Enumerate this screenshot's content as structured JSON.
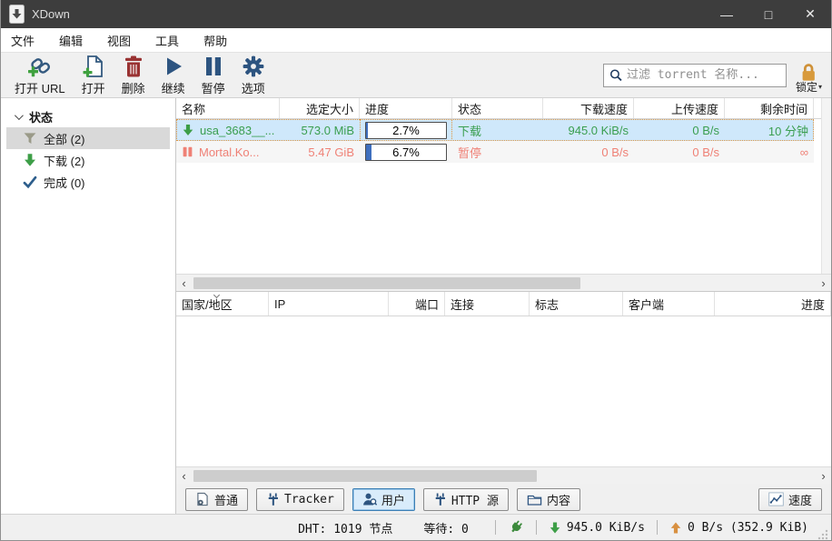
{
  "window": {
    "title": "XDown",
    "controls": {
      "minimize": "—",
      "maximize": "□",
      "close": "✕"
    }
  },
  "menu": {
    "items": [
      "文件",
      "编辑",
      "视图",
      "工具",
      "帮助"
    ]
  },
  "toolbar": {
    "buttons": [
      {
        "label": "打开 URL",
        "icon": "link-add-icon"
      },
      {
        "label": "打开",
        "icon": "file-add-icon"
      },
      {
        "label": "删除",
        "icon": "trash-icon"
      },
      {
        "label": "继续",
        "icon": "play-icon"
      },
      {
        "label": "暂停",
        "icon": "pause-icon"
      },
      {
        "label": "选项",
        "icon": "gear-icon"
      }
    ],
    "search": {
      "placeholder": "过滤 torrent 名称..."
    },
    "lock": {
      "label": "锁定",
      "dropdown": "▾"
    }
  },
  "sidebar": {
    "header": "状态",
    "items": [
      {
        "label": "全部 (2)",
        "icon": "filter-icon",
        "selected": true
      },
      {
        "label": "下载 (2)",
        "icon": "download-arrow-icon",
        "selected": false
      },
      {
        "label": "完成 (0)",
        "icon": "check-icon",
        "selected": false
      }
    ]
  },
  "downloads_table": {
    "columns": [
      "名称",
      "选定大小",
      "进度",
      "状态",
      "下载速度",
      "上传速度",
      "剩余时间"
    ],
    "rows": [
      {
        "name": "usa_3683__...",
        "size": "573.0 MiB",
        "progress": "2.7%",
        "progress_value": 2.7,
        "status": "下载",
        "down_speed": "945.0 KiB/s",
        "up_speed": "0 B/s",
        "eta": "10 分钟",
        "state": "downloading",
        "selected": true
      },
      {
        "name": "Mortal.Ko...",
        "size": "5.47 GiB",
        "progress": "6.7%",
        "progress_value": 6.7,
        "status": "暂停",
        "down_speed": "0 B/s",
        "up_speed": "0 B/s",
        "eta": "∞",
        "state": "paused",
        "selected": false
      }
    ]
  },
  "peers_table": {
    "columns": [
      "国家/地区",
      "IP",
      "端口",
      "连接",
      "标志",
      "客户端",
      "进度"
    ],
    "rows": []
  },
  "bottom_tabs": {
    "tabs": [
      {
        "label": "普通",
        "icon": "general-icon",
        "active": false
      },
      {
        "label": "Tracker",
        "icon": "tracker-icon",
        "active": false
      },
      {
        "label": "用户",
        "icon": "peers-icon",
        "active": true
      },
      {
        "label": "HTTP 源",
        "icon": "http-source-icon",
        "active": false
      },
      {
        "label": "内容",
        "icon": "content-folder-icon",
        "active": false
      }
    ],
    "speed_button": {
      "label": "速度",
      "icon": "speed-chart-icon"
    }
  },
  "status_bar": {
    "dht": "DHT: 1019 节点",
    "waiting": "等待: 0",
    "down_speed": "945.0 KiB/s",
    "up_speed": "0 B/s (352.9 KiB)"
  },
  "icons_text": {
    "scroll_left": "‹",
    "scroll_right": "›"
  },
  "colors": {
    "titlebar": "#3d3d3d",
    "toolbar_icon_blue": "#2d5480",
    "green": "#3a9e4f",
    "salmon": "#ef8176",
    "selection": "#cfe8fb",
    "focus_dotted": "#e0953f",
    "progress_fill": "#3f6fbe",
    "lock_orange": "#d89a3c"
  }
}
